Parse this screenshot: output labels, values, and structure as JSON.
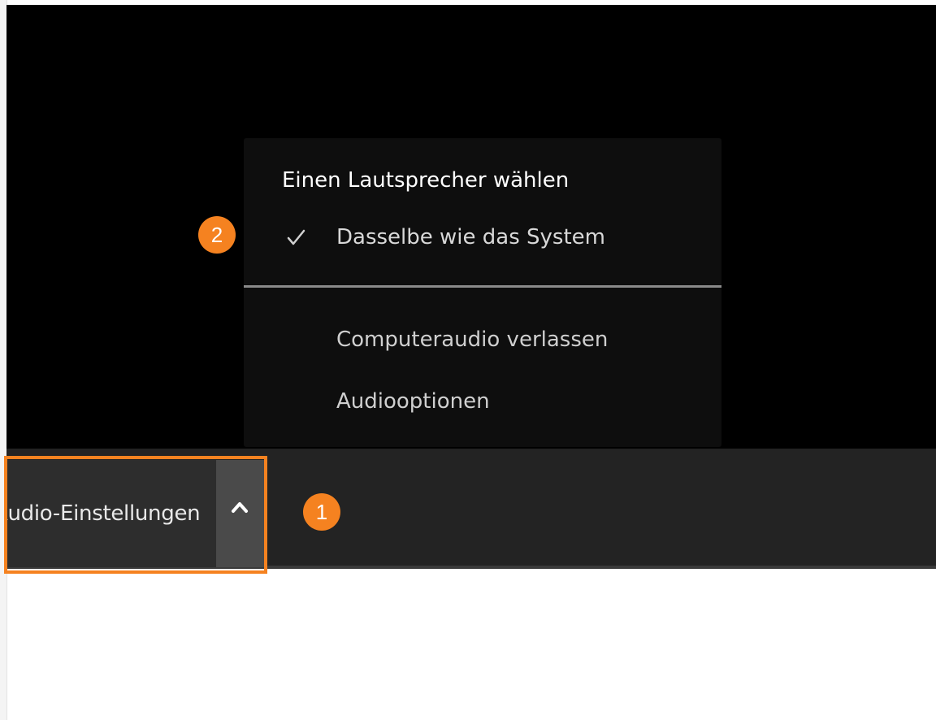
{
  "toolbar": {
    "audio_button_label": "Audio-Einstellungen",
    "caret_icon": "chevron-up-icon"
  },
  "menu": {
    "header": "Einen Lautsprecher wählen",
    "items": [
      {
        "label": "Dasselbe wie das System",
        "selected": true,
        "icon": "checkmark-icon"
      },
      {
        "label": "Computeraudio verlassen",
        "selected": false
      },
      {
        "label": "Audiooptionen",
        "selected": false
      }
    ]
  },
  "annotations": {
    "badge_1": "1",
    "badge_2": "2",
    "accent_color": "#f58220"
  }
}
